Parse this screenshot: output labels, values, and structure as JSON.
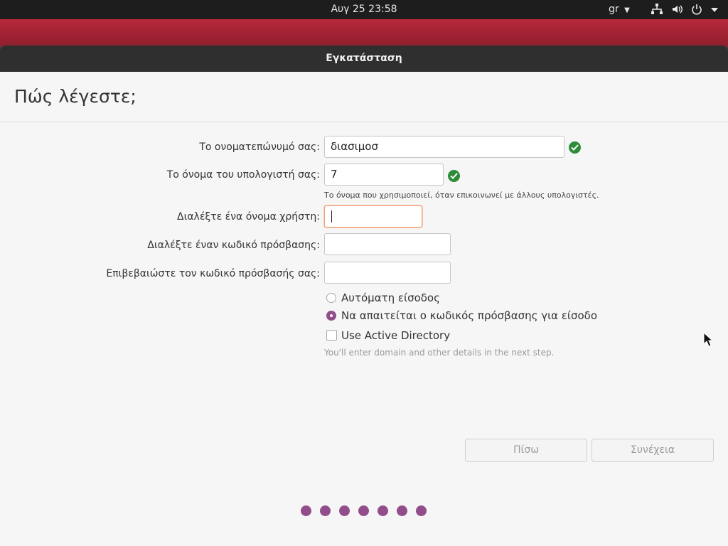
{
  "topbar": {
    "datetime": "Αυγ 25  23:58",
    "keyboard_layout": "gr",
    "icons": [
      "network-icon",
      "volume-icon",
      "power-icon",
      "menu-down-icon"
    ]
  },
  "window": {
    "title": "Εγκατάσταση"
  },
  "page": {
    "heading": "Πώς λέγεστε;"
  },
  "form": {
    "fullname": {
      "label": "Το ονοματεπώνυμό σας:",
      "value": "διασιμοσ",
      "valid": true
    },
    "computer_name": {
      "label": "Το όνομα του υπολογιστή σας:",
      "value": "7",
      "valid": true,
      "hint": "Το όνομα που χρησιμοποιεί, όταν επικοινωνεί με άλλους υπολογιστές."
    },
    "username": {
      "label": "Διαλέξτε ένα όνομα χρήστη:",
      "value": ""
    },
    "password": {
      "label": "Διαλέξτε έναν κωδικό πρόσβασης:",
      "value": ""
    },
    "confirm_password": {
      "label": "Επιβεβαιώστε τον κωδικό πρόσβασής σας:",
      "value": ""
    }
  },
  "login_options": {
    "auto_login": {
      "label": "Αυτόματη είσοδος",
      "selected": false
    },
    "require_password": {
      "label": "Να απαιτείται ο κωδικός πρόσβασης για είσοδο",
      "selected": true
    }
  },
  "active_directory": {
    "label": "Use Active Directory",
    "checked": false,
    "hint": "You'll enter domain and other details in the next step."
  },
  "buttons": {
    "back": "Πίσω",
    "continue": "Συνέχεια"
  },
  "progress": {
    "dot_count": 7
  },
  "colors": {
    "accent": "#924d8b",
    "valid_check": "#2e8b3a",
    "desktop": "#a3233a"
  }
}
